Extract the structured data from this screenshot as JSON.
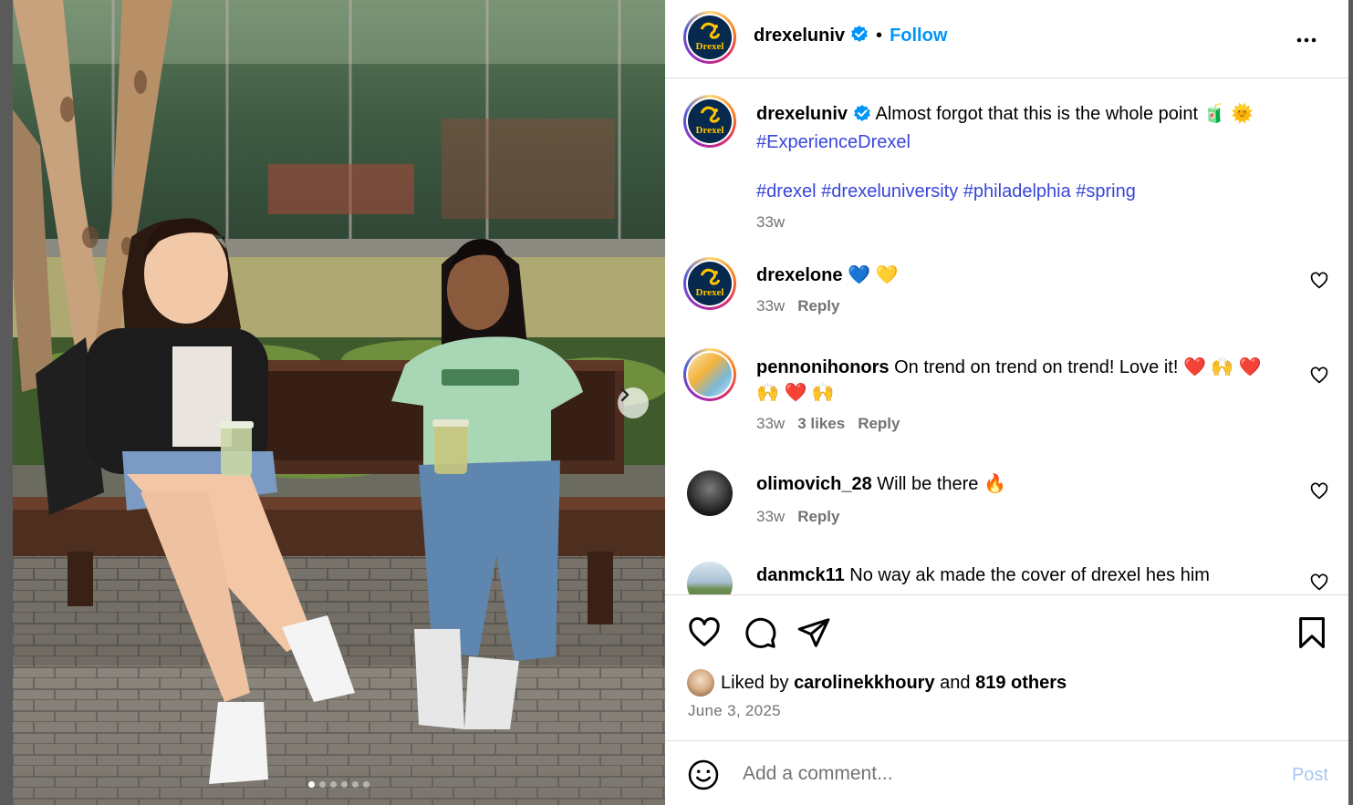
{
  "post": {
    "author": "drexeluniv",
    "follow_label": "Follow",
    "bullet": "•",
    "more_icon": "more-horizontal-icon",
    "avatar_text": "Drexel",
    "carousel": {
      "slide_count": 6,
      "active_index": 0
    }
  },
  "caption": {
    "author": "drexeluniv",
    "text": "Almost forgot that this is the whole point",
    "emoji": "🧃 🌞",
    "hashtag_line1": "#ExperienceDrexel",
    "hashtags": [
      "#drexel",
      "#drexeluniversity",
      "#philadelphia",
      "#spring"
    ],
    "time": "33w"
  },
  "comments": [
    {
      "user": "drexelone",
      "text": "💙 💛",
      "time": "33w",
      "likes": "",
      "reply": "Reply"
    },
    {
      "user": "pennonihonors",
      "text": "On trend on trend on trend! Love it! ❤️ 🙌 ❤️",
      "text2": "🙌 ❤️ 🙌",
      "time": "33w",
      "likes": "3 likes",
      "reply": "Reply"
    },
    {
      "user": "olimovich_28",
      "text": "Will be there 🔥",
      "time": "33w",
      "likes": "",
      "reply": "Reply"
    },
    {
      "user": "danmck11",
      "text": "No way ak made the cover of drexel hes him",
      "time": "",
      "likes": "",
      "reply": ""
    }
  ],
  "actions": {
    "liked_prefix": "Liked by",
    "liked_user": "carolinekkhoury",
    "liked_and": "and",
    "liked_others": "819 others",
    "date": "June 3, 2025"
  },
  "comment_box": {
    "placeholder": "Add a comment...",
    "post_label": "Post"
  },
  "colors": {
    "link_blue": "#0095f6",
    "hashtag": "#3845d9",
    "secondary_text": "#737373",
    "post_disabled": "#a7c8f2",
    "drexel_navy": "#07294d",
    "drexel_gold": "#ffc600"
  }
}
